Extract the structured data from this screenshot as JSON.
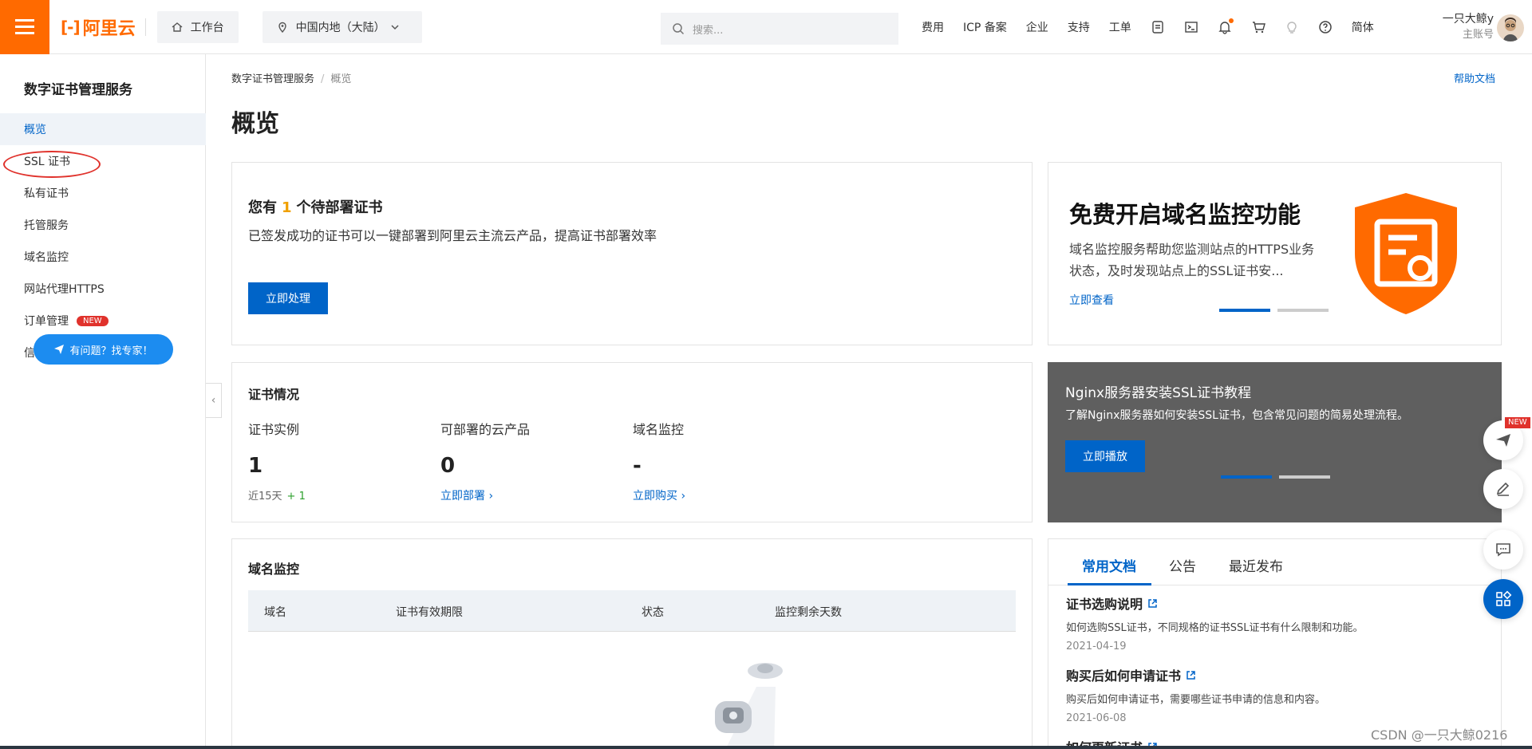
{
  "topbar": {
    "logo_text": "阿里云",
    "logo_mark": "[-]",
    "workbench": "工作台",
    "region": "中国内地（大陆）",
    "search_placeholder": "搜索...",
    "links": [
      "费用",
      "ICP 备案",
      "企业",
      "支持",
      "工单"
    ],
    "lang": "简体",
    "user_name": "一只大鲸y",
    "user_role": "主账号"
  },
  "sidebar": {
    "title": "数字证书管理服务",
    "items": [
      {
        "label": "概览"
      },
      {
        "label": "SSL 证书"
      },
      {
        "label": "私有证书"
      },
      {
        "label": "托管服务"
      },
      {
        "label": "域名监控"
      },
      {
        "label": "网站代理HTTPS"
      },
      {
        "label": "订单管理",
        "badge": "NEW"
      },
      {
        "label": "信息管理"
      }
    ],
    "expert_button": "有问题？找专家！"
  },
  "breadcrumb": {
    "root": "数字证书管理服务",
    "sep": "/",
    "current": "概览"
  },
  "help_link": "帮助文档",
  "page_title": "概览",
  "pending": {
    "prefix": "您有",
    "count": "1",
    "suffix": "个待部署证书",
    "desc": "已签发成功的证书可以一键部署到阿里云主流云产品，提高证书部署效率",
    "button": "立即处理"
  },
  "promo_monitor": {
    "title": "免费开启域名监控功能",
    "desc": "域名监控服务帮助您监测站点的HTTPS业务状态，及时发现站点上的SSL证书安...",
    "link": "立即查看"
  },
  "cert_status": {
    "title": "证书情况",
    "stats": [
      {
        "label": "证书实例",
        "value": "1",
        "sub": "近15天",
        "delta": "+ 1"
      },
      {
        "label": "可部署的云产品",
        "value": "0",
        "link": "立即部署"
      },
      {
        "label": "域名监控",
        "value": "-",
        "link": "立即购买"
      }
    ]
  },
  "promo_nginx": {
    "title": "Nginx服务器安装SSL证书教程",
    "desc": "了解Nginx服务器如何安装SSL证书，包含常见问题的简易处理流程。",
    "button": "立即播放"
  },
  "domain_monitor": {
    "title": "域名监控",
    "columns": [
      "域名",
      "证书有效期限",
      "状态",
      "监控剩余天数"
    ]
  },
  "docs": {
    "tabs": [
      "常用文档",
      "公告",
      "最近发布"
    ],
    "items": [
      {
        "title": "证书选购说明",
        "desc": "如何选购SSL证书，不同规格的证书SSL证书有什么限制和功能。",
        "date": "2021-04-19"
      },
      {
        "title": "购买后如何申请证书",
        "desc": "购买后如何申请证书，需要哪些证书申请的信息和内容。",
        "date": "2021-06-08"
      },
      {
        "title": "如何更新证书",
        "desc": "",
        "date": ""
      }
    ]
  },
  "float_new_badge": "NEW",
  "watermark": "CSDN @一只大鲸0216",
  "colors": {
    "brand": "#ff6a00",
    "primary": "#0064c8",
    "annotation": "#e0322c"
  }
}
